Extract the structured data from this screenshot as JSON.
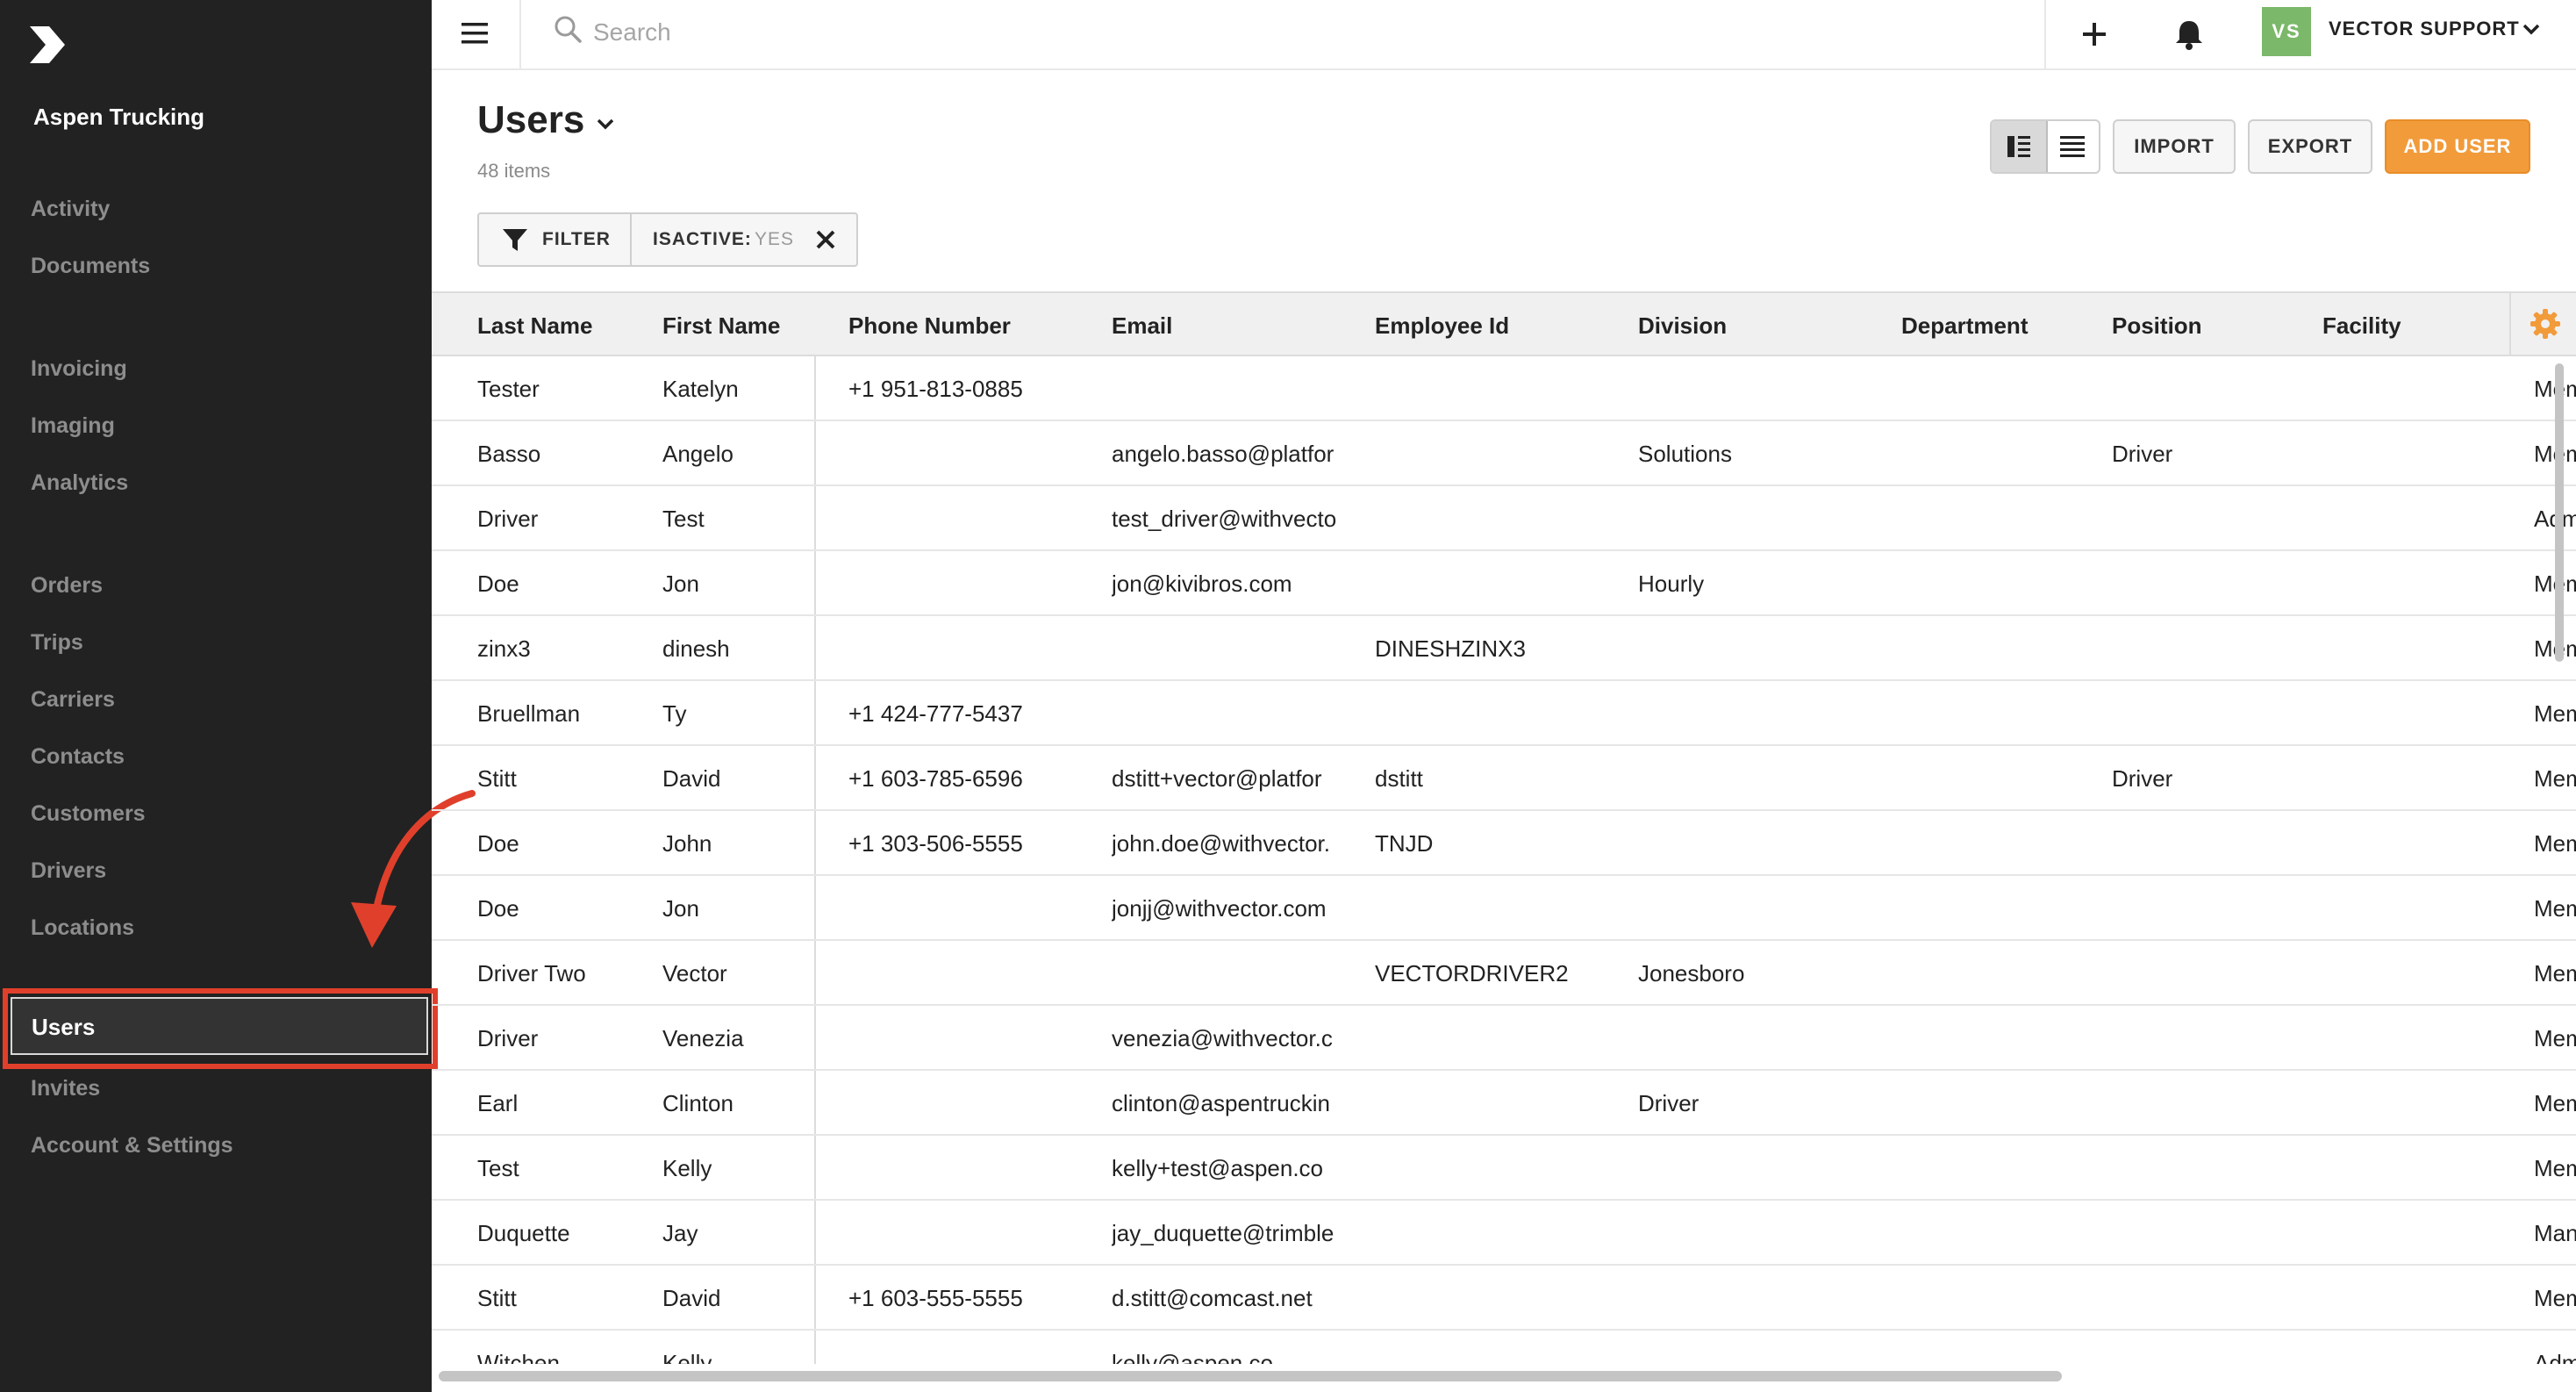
{
  "sidebar": {
    "company": "Aspen Trucking",
    "items": [
      {
        "label": "Activity"
      },
      {
        "label": "Documents"
      },
      {
        "label": "Invoicing"
      },
      {
        "label": "Imaging"
      },
      {
        "label": "Analytics"
      },
      {
        "label": "Orders"
      },
      {
        "label": "Trips"
      },
      {
        "label": "Carriers"
      },
      {
        "label": "Contacts"
      },
      {
        "label": "Customers"
      },
      {
        "label": "Drivers"
      },
      {
        "label": "Locations"
      },
      {
        "label": "Users"
      },
      {
        "label": "Invites"
      },
      {
        "label": "Account & Settings"
      }
    ],
    "active": "Users"
  },
  "topbar": {
    "search_placeholder": "Search",
    "avatar_initials": "VS",
    "user_name": "VECTOR SUPPORT"
  },
  "page": {
    "title": "Users",
    "count": "48 items"
  },
  "toolbar": {
    "import_label": "IMPORT",
    "export_label": "EXPORT",
    "add_label": "ADD USER"
  },
  "filter": {
    "label": "FILTER",
    "chip_key": "ISACTIVE:",
    "chip_value": "YES"
  },
  "table": {
    "columns": [
      "Last Name",
      "First Name",
      "Phone Number",
      "Email",
      "Employee Id",
      "Division",
      "Department",
      "Position",
      "Facility"
    ],
    "rows": [
      {
        "last": "Tester",
        "first": "Katelyn",
        "phone": "+1 951-813-0885",
        "email": "",
        "emp": "",
        "division": "",
        "department": "",
        "position": "",
        "facility": "",
        "extra": "Mem"
      },
      {
        "last": "Basso",
        "first": "Angelo",
        "phone": "",
        "email": "angelo.basso@platfor",
        "emp": "",
        "division": "Solutions",
        "department": "",
        "position": "Driver",
        "facility": "",
        "extra": "Mem"
      },
      {
        "last": "Driver",
        "first": "Test",
        "phone": "",
        "email": "test_driver@withvecto",
        "emp": "",
        "division": "",
        "department": "",
        "position": "",
        "facility": "",
        "extra": "Adm"
      },
      {
        "last": "Doe",
        "first": "Jon",
        "phone": "",
        "email": "jon@kivibros.com",
        "emp": "",
        "division": "Hourly",
        "department": "",
        "position": "",
        "facility": "",
        "extra": "Mem"
      },
      {
        "last": "zinx3",
        "first": "dinesh",
        "phone": "",
        "email": "",
        "emp": "DINESHZINX3",
        "division": "",
        "department": "",
        "position": "",
        "facility": "",
        "extra": "Mem"
      },
      {
        "last": "Bruellman",
        "first": "Ty",
        "phone": "+1 424-777-5437",
        "email": "",
        "emp": "",
        "division": "",
        "department": "",
        "position": "",
        "facility": "",
        "extra": "Mem"
      },
      {
        "last": "Stitt",
        "first": "David",
        "phone": "+1 603-785-6596",
        "email": "dstitt+vector@platfor",
        "emp": "dstitt",
        "division": "",
        "department": "",
        "position": "Driver",
        "facility": "",
        "extra": "Mem"
      },
      {
        "last": "Doe",
        "first": "John",
        "phone": "+1 303-506-5555",
        "email": "john.doe@withvector.",
        "emp": "TNJD",
        "division": "",
        "department": "",
        "position": "",
        "facility": "",
        "extra": "Mem"
      },
      {
        "last": "Doe",
        "first": "Jon",
        "phone": "",
        "email": "jonjj@withvector.com",
        "emp": "",
        "division": "",
        "department": "",
        "position": "",
        "facility": "",
        "extra": "Mem"
      },
      {
        "last": "Driver Two",
        "first": "Vector",
        "phone": "",
        "email": "",
        "emp": "VECTORDRIVER2",
        "division": "Jonesboro",
        "department": "",
        "position": "",
        "facility": "",
        "extra": "Mem"
      },
      {
        "last": "Driver",
        "first": "Venezia",
        "phone": "",
        "email": "venezia@withvector.c",
        "emp": "",
        "division": "",
        "department": "",
        "position": "",
        "facility": "",
        "extra": "Mem"
      },
      {
        "last": "Earl",
        "first": "Clinton",
        "phone": "",
        "email": "clinton@aspentruckin",
        "emp": "",
        "division": "Driver",
        "department": "",
        "position": "",
        "facility": "",
        "extra": "Mem"
      },
      {
        "last": "Test",
        "first": "Kelly",
        "phone": "",
        "email": "kelly+test@aspen.co",
        "emp": "",
        "division": "",
        "department": "",
        "position": "",
        "facility": "",
        "extra": "Mem"
      },
      {
        "last": "Duquette",
        "first": "Jay",
        "phone": "",
        "email": "jay_duquette@trimble",
        "emp": "",
        "division": "",
        "department": "",
        "position": "",
        "facility": "",
        "extra": "Man"
      },
      {
        "last": "Stitt",
        "first": "David",
        "phone": "+1 603-555-5555",
        "email": "d.stitt@comcast.net",
        "emp": "",
        "division": "",
        "department": "",
        "position": "",
        "facility": "",
        "extra": "Mem"
      },
      {
        "last": "Witchen",
        "first": "Kelly",
        "phone": "",
        "email": "kelly@aspen.co",
        "emp": "",
        "division": "",
        "department": "",
        "position": "",
        "facility": "",
        "extra": "Adm"
      }
    ]
  },
  "colors": {
    "sidebar_bg": "#222222",
    "accent_orange": "#f29b3a",
    "highlight_red": "#e0402b",
    "avatar_green": "#7bb86a"
  },
  "icons": [
    "logo-icon",
    "hamburger-icon",
    "search-icon",
    "plus-icon",
    "bell-icon",
    "chevron-down-icon",
    "split-view-icon",
    "list-view-icon",
    "filter-icon",
    "close-icon",
    "gear-icon",
    "annotation-arrow"
  ]
}
